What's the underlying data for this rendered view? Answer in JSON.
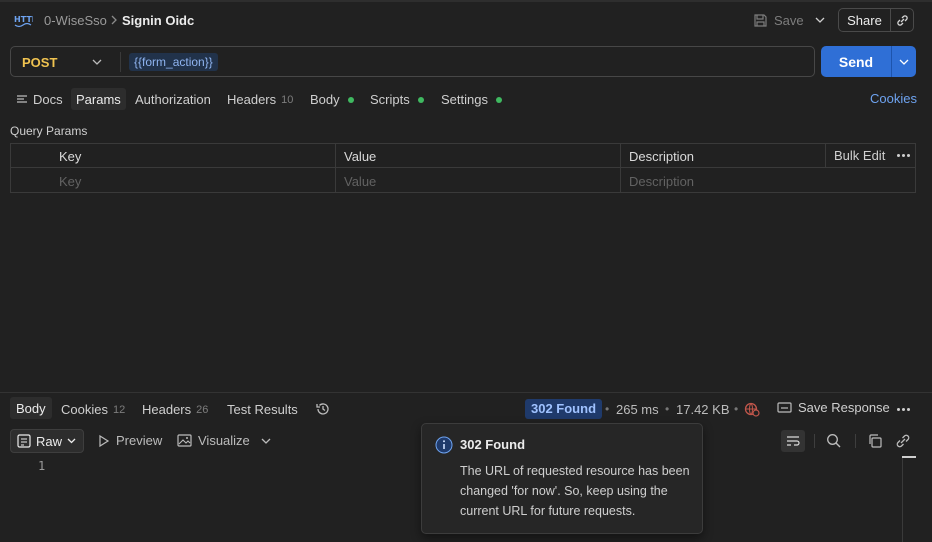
{
  "header": {
    "request_type": "HTTP",
    "collection": "0-WiseSso",
    "request_name": "Signin Oidc",
    "save_label": "Save",
    "share_label": "Share"
  },
  "request": {
    "method": "POST",
    "url": "{{form_action}}",
    "send_label": "Send"
  },
  "request_tabs": {
    "docs": "Docs",
    "params": "Params",
    "authorization": "Authorization",
    "headers": "Headers",
    "headers_count": "10",
    "body": "Body",
    "scripts": "Scripts",
    "settings": "Settings",
    "cookies": "Cookies",
    "dot_color": "#3fb960"
  },
  "query_params": {
    "title": "Query Params",
    "columns": [
      "Key",
      "Value",
      "Description"
    ],
    "bulk_edit": "Bulk Edit",
    "placeholders": [
      "Key",
      "Value",
      "Description"
    ]
  },
  "response": {
    "tabs": {
      "body": "Body",
      "cookies": "Cookies",
      "cookies_count": "12",
      "headers": "Headers",
      "headers_count": "26",
      "test_results": "Test Results"
    },
    "status": "302 Found",
    "time": "265 ms",
    "size": "17.42 KB",
    "save_response": "Save Response",
    "view_modes": {
      "raw": "Raw",
      "preview": "Preview",
      "visualize": "Visualize"
    },
    "line_numbers": [
      "1"
    ]
  },
  "tooltip": {
    "title": "302 Found",
    "body": "The URL of requested resource has been changed 'for now'. So, keep using the current URL for future requests."
  },
  "colors": {
    "accent": "#2f6fd6",
    "method": "#f0c350",
    "link": "#6ea3f0",
    "status_bg": "#1f3a6b"
  }
}
